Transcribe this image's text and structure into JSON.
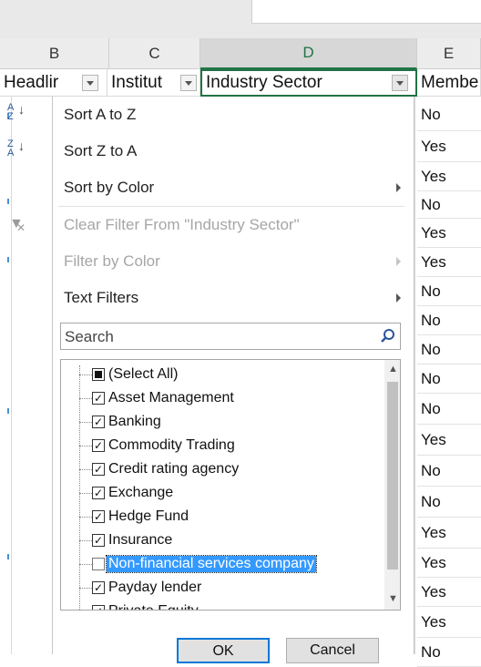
{
  "columns": {
    "headers": [
      "B",
      "C",
      "D",
      "E"
    ],
    "selected": "D"
  },
  "header_cells": {
    "b": "Headlir",
    "c": "Institut",
    "d": "Industry Sector",
    "e": "Membe"
  },
  "column_e_values": [
    "No",
    "Yes",
    "Yes",
    "No",
    "Yes",
    "Yes",
    "No",
    "No",
    "No",
    "No",
    "No",
    "Yes",
    "No",
    "No",
    "Yes",
    "Yes",
    "Yes",
    "Yes",
    "No"
  ],
  "menu": {
    "sort_az": "Sort A to Z",
    "sort_za": "Sort Z to A",
    "sort_by_color": "Sort by Color",
    "clear_filter": "Clear Filter From \"Industry Sector\"",
    "filter_by_color": "Filter by Color",
    "text_filters": "Text Filters"
  },
  "search": {
    "placeholder": "Search"
  },
  "filter_list": [
    {
      "label": "(Select All)",
      "state": "partial"
    },
    {
      "label": "Asset Management",
      "state": "checked"
    },
    {
      "label": "Banking",
      "state": "checked"
    },
    {
      "label": "Commodity Trading",
      "state": "checked"
    },
    {
      "label": "Credit rating agency",
      "state": "checked"
    },
    {
      "label": "Exchange",
      "state": "checked"
    },
    {
      "label": "Hedge Fund",
      "state": "checked"
    },
    {
      "label": "Insurance",
      "state": "checked"
    },
    {
      "label": "Non-financial services company",
      "state": "unchecked",
      "highlighted": true
    },
    {
      "label": "Payday lender",
      "state": "checked"
    },
    {
      "label": "Private Equity",
      "state": "checked"
    }
  ],
  "buttons": {
    "ok": "OK",
    "cancel": "Cancel"
  },
  "colors": {
    "accent": "#217346",
    "highlight": "#3399ff"
  }
}
